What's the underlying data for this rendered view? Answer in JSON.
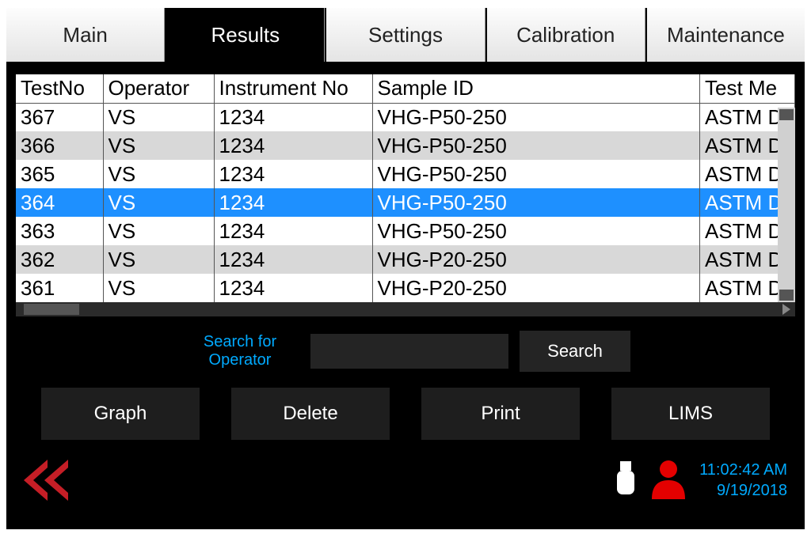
{
  "tabs": {
    "main": "Main",
    "results": "Results",
    "settings": "Settings",
    "calibration": "Calibration",
    "maintenance": "Maintenance",
    "active": "results"
  },
  "columns": {
    "testno": "TestNo",
    "operator": "Operator",
    "instrument": "Instrument No",
    "sample": "Sample ID",
    "method": "Test Me"
  },
  "rows": [
    {
      "testno": "367",
      "operator": "VS",
      "instrument": "1234",
      "sample": "VHG-P50-250",
      "method": "ASTM D"
    },
    {
      "testno": "366",
      "operator": "VS",
      "instrument": "1234",
      "sample": "VHG-P50-250",
      "method": "ASTM D"
    },
    {
      "testno": "365",
      "operator": "VS",
      "instrument": "1234",
      "sample": "VHG-P50-250",
      "method": "ASTM D"
    },
    {
      "testno": "364",
      "operator": "VS",
      "instrument": "1234",
      "sample": "VHG-P50-250",
      "method": "ASTM D"
    },
    {
      "testno": "363",
      "operator": "VS",
      "instrument": "1234",
      "sample": "VHG-P50-250",
      "method": "ASTM D"
    },
    {
      "testno": "362",
      "operator": "VS",
      "instrument": "1234",
      "sample": "VHG-P20-250",
      "method": "ASTM D"
    },
    {
      "testno": "361",
      "operator": "VS",
      "instrument": "1234",
      "sample": "VHG-P20-250",
      "method": "ASTM D"
    }
  ],
  "selected_testno": "364",
  "search": {
    "label_line1": "Search for",
    "label_line2": "Operator",
    "value": "",
    "button": "Search"
  },
  "actions": {
    "graph": "Graph",
    "delete": "Delete",
    "print": "Print",
    "lims": "LIMS"
  },
  "footer": {
    "time": "11:02:42 AM",
    "date": "9/19/2018"
  }
}
